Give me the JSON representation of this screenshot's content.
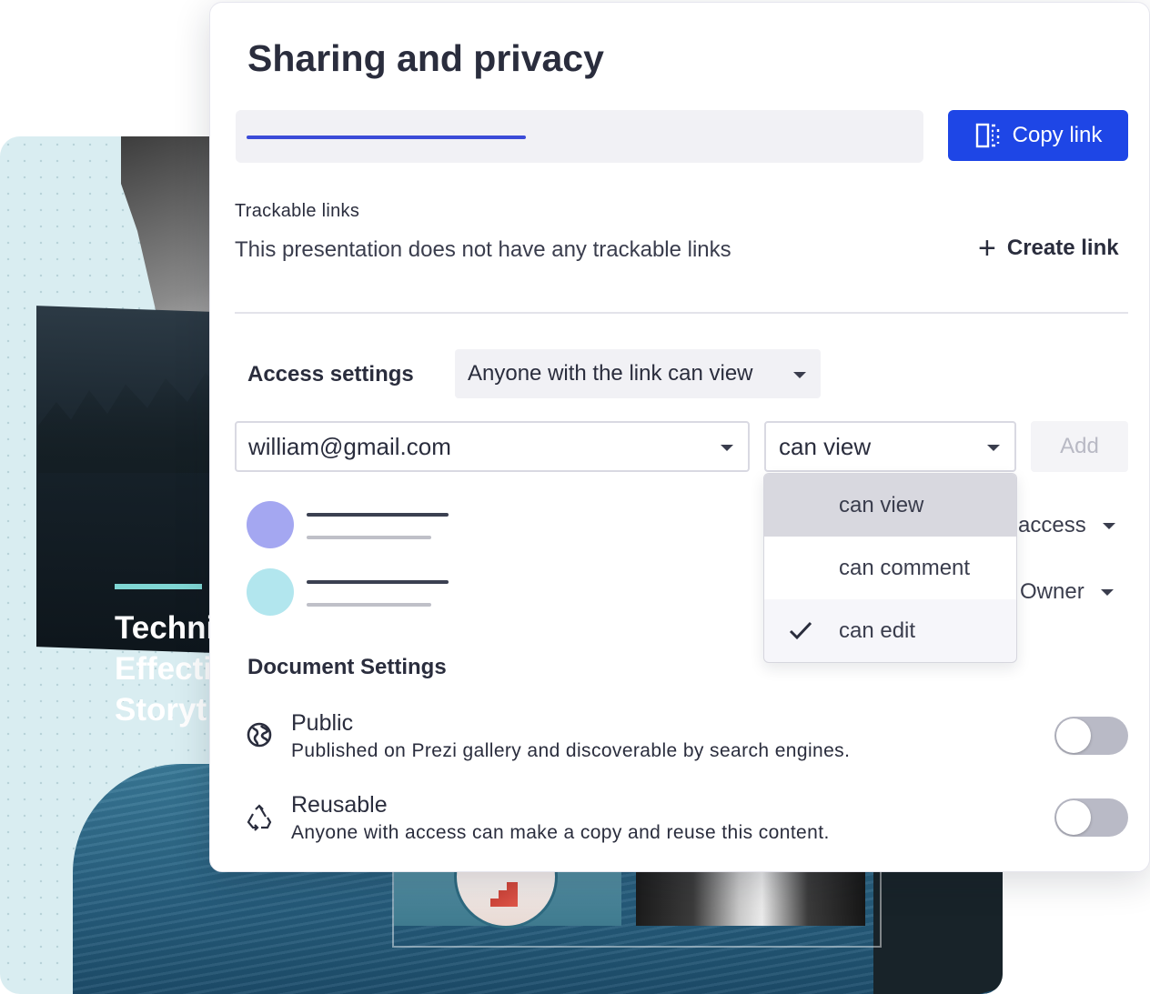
{
  "background": {
    "slide_title": "Techni\nEffecti\nStoryt"
  },
  "dialog": {
    "title": "Sharing and privacy",
    "link_progress": 0.42,
    "copy_link_label": "Copy link",
    "copy_icon": "copy-link-icon"
  },
  "trackable": {
    "label": "Trackable links",
    "description": "This presentation does not have any trackable links",
    "create_label": "Create link",
    "create_icon": "plus-icon"
  },
  "access": {
    "label": "Access settings",
    "value": "Anyone with the link can view"
  },
  "invite": {
    "email": "william@gmail.com",
    "permission": "can view",
    "add_label": "Add"
  },
  "members": [
    {
      "avatar_color": "#a4a7f1",
      "role": "access"
    },
    {
      "avatar_color": "#b2e6ee",
      "role": "Owner"
    }
  ],
  "permission_menu": {
    "items": [
      "can view",
      "can comment",
      "can edit"
    ],
    "highlighted": "can view",
    "checked": "can edit"
  },
  "document_settings": {
    "label": "Document Settings",
    "items": [
      {
        "icon": "globe-icon",
        "title": "Public",
        "description": "Published on Prezi gallery and discoverable by search engines.",
        "enabled": false
      },
      {
        "icon": "recycle-icon",
        "title": "Reusable",
        "description": "Anyone with access can make a copy and reuse this content.",
        "enabled": false
      }
    ]
  },
  "colors": {
    "accent": "#1e46e6",
    "progress": "#3b4bd8",
    "toggle_off": "#b9bac6"
  }
}
